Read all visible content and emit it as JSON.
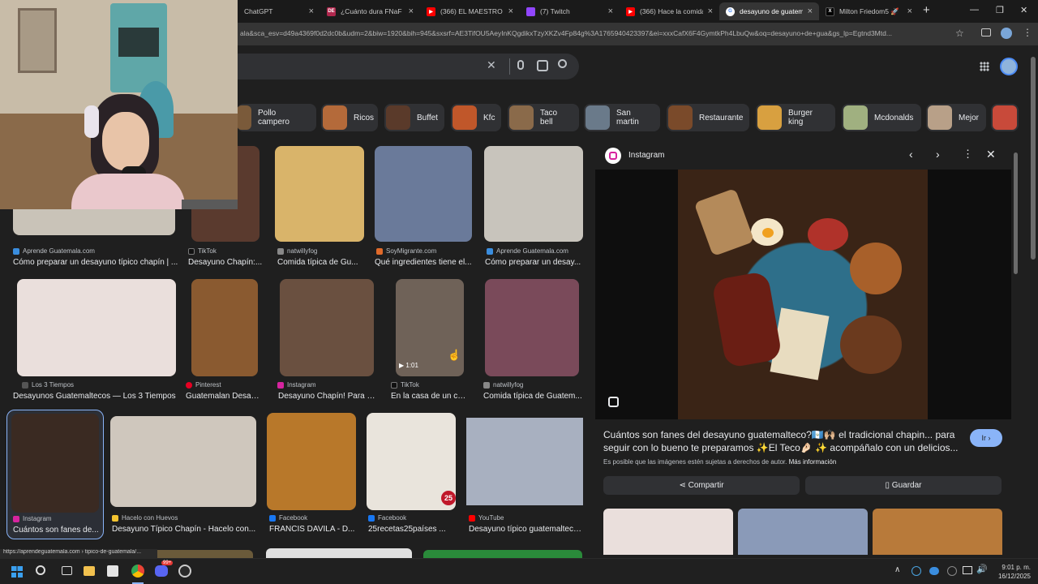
{
  "tabs": [
    {
      "title": "ChatGPT",
      "color": "#0f0f0f"
    },
    {
      "title": "¿Cuánto dura FNaF W",
      "color": "#b0274d",
      "badge": "DE"
    },
    {
      "title": "(366) EL MAESTRO S",
      "color": "#ff0000"
    },
    {
      "title": "(7) Twitch",
      "color": "#9146ff"
    },
    {
      "title": "(366) Hace la comida",
      "color": "#ff0000"
    },
    {
      "title": "desayuno de guatem",
      "color": "#4285f4",
      "active": true
    },
    {
      "title": "Milton Friedom5 🚀",
      "color": "#000000"
    }
  ],
  "window": {
    "minimize": "—",
    "maximize": "❐",
    "close": "✕",
    "newtab": "+"
  },
  "address": {
    "url": "ala&sca_esv=d49a4369f0d2dc0b&udm=2&biw=1920&bih=945&sxsrf=AE3TifOU5AeyInKQgdikxTzyXKZv4Fp84g%3A1765940423397&ei=xxxCafX6F4GymtkPh4LbuQw&oq=desayuno+de+gua&gs_lp=Egtnd3Mtd..."
  },
  "search": {
    "clear": "✕"
  },
  "chips": [
    {
      "label": "Pollo campero",
      "color": "#7a5a3a"
    },
    {
      "label": "Ricos",
      "color": "#b46a3a"
    },
    {
      "label": "Buffet",
      "color": "#5a3a2a"
    },
    {
      "label": "Kfc",
      "color": "#c0572a"
    },
    {
      "label": "Taco bell",
      "color": "#8a6a4a"
    },
    {
      "label": "San martin",
      "color": "#6a7a8a"
    },
    {
      "label": "Restaurante",
      "color": "#7a4a2a"
    },
    {
      "label": "Burger king",
      "color": "#d8a040"
    },
    {
      "label": "Mcdonalds",
      "color": "#a0b080"
    },
    {
      "label": "Mejor",
      "color": "#b8a088"
    }
  ],
  "grid": [
    {
      "src": "Aprende Guatemala.com",
      "cap": "Cómo preparar un desayuno típico chapín | ...",
      "sc": "#3a8dde",
      "bg": "#c9c3b8"
    },
    {
      "src": "TikTok",
      "cap": "Desayuno Chapín:...",
      "sc": "#111111",
      "bg": "#5a3a2e"
    },
    {
      "src": "natwillyfog",
      "cap": "Comida típica de Gu...",
      "sc": "#888888",
      "bg": "#d9b46a"
    },
    {
      "src": "SoyMigrante.com",
      "cap": "Qué ingredientes tiene el...",
      "sc": "#e06a2a",
      "bg": "#6a7a9a"
    },
    {
      "src": "Aprende Guatemala.com",
      "cap": "Cómo preparar un desay...",
      "sc": "#3a8dde",
      "bg": "#c8c4bc"
    },
    {
      "src": "Los 3 Tiempos",
      "cap": "Desayunos Guatemaltecos — Los 3 Tiempos",
      "sc": "#555555",
      "bg": "#eadfdc"
    },
    {
      "src": "Pinterest",
      "cap": "Guatemalan Desay...",
      "sc": "#e60023",
      "bg": "#8a5a30"
    },
    {
      "src": "Instagram",
      "cap": "Desayuno Chapín! Para e...",
      "sc": "#d6249f",
      "bg": "#6a5040"
    },
    {
      "src": "TikTok",
      "cap": "En la casa de un ch...",
      "sc": "#111111",
      "bg": "#6f6258",
      "dur": "1:01"
    },
    {
      "src": "natwillyfog",
      "cap": "Comida típica de Guatem...",
      "sc": "#888888",
      "bg": "#7a4a5a"
    },
    {
      "src": "Instagram",
      "cap": "Cuántos son fanes de...",
      "sc": "#d6249f",
      "bg": "#3a2a22"
    },
    {
      "src": "Hacelo con Huevos",
      "cap": "Desayuno Típico Chapín - Hacelo con...",
      "sc": "#f4c430",
      "bg": "#cfc7bd"
    },
    {
      "src": "Facebook",
      "cap": "FRANCIS DAVILA - D...",
      "sc": "#1877f2",
      "bg": "#b8782a"
    },
    {
      "src": "Facebook",
      "cap": "25recetas25países ...",
      "sc": "#1877f2",
      "bg": "#e9e4dc",
      "badge": "25"
    },
    {
      "src": "YouTube",
      "cap": "Desayuno típico guatemalteco...",
      "sc": "#ff0000",
      "bg": "#a8b0c0"
    }
  ],
  "panel": {
    "source": "Instagram",
    "title": "Cuántos son fanes del desayuno guatemalteco?🇬🇹🙌🏼 el tradicional chapin... para seguir con lo bueno te preparamos ✨El Teco🤌🏻 ✨ acompáñalo con un delicios...",
    "go": "Ir",
    "rights": "Es posible que las imágenes estén sujetas a derechos de autor.",
    "more": "Más información",
    "share": "Compartir",
    "save": "Guardar"
  },
  "status_url": "https://aprendeguatemala.com › tipico-de-guatemala/...",
  "clock": {
    "time": "9:01 p. m.",
    "date": "16/12/2025"
  },
  "taskbar_badge": "99+"
}
